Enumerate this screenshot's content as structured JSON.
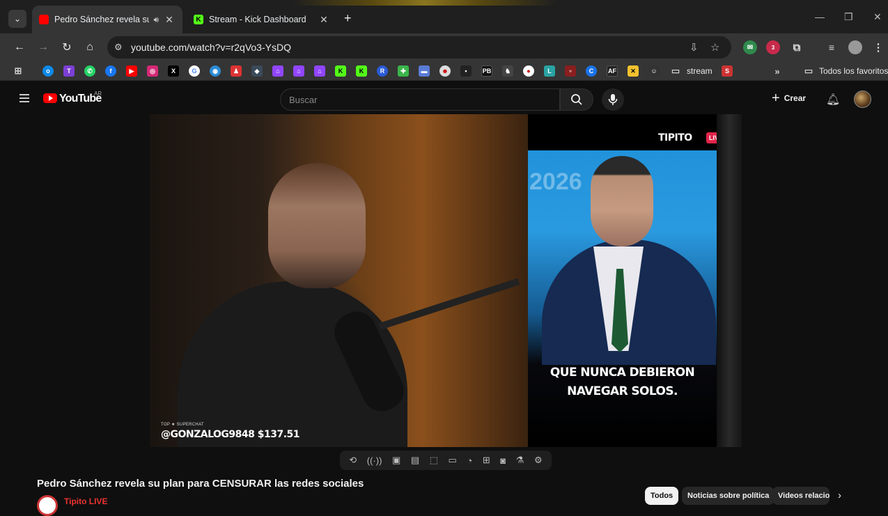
{
  "browser": {
    "tabs": [
      {
        "title": "Pedro Sánchez revela su plan para CENSURAR las redes sociales",
        "favicon": "youtube-icon",
        "active": true,
        "audio": true
      },
      {
        "title": "Stream - Kick Dashboard",
        "favicon": "kick-icon",
        "active": false,
        "audio": false
      }
    ],
    "url": "youtube.com/watch?v=r2qVo3-YsDQ",
    "extension_badge": "3",
    "bookmarks": {
      "folder_label": "stream",
      "all_bookmarks_label": "Todos los favoritos",
      "ext_badge_text": "AF"
    }
  },
  "youtube": {
    "logo_text": "YouTube",
    "country_code": "AR",
    "search_placeholder": "Buscar",
    "create_label": "Crear",
    "video": {
      "title": "Pedro Sánchez revela su plan para CENSURAR las redes sociales",
      "superchat_tag": "TOP ★ SUPERCHAT",
      "superchat_text": "@GONZALOG9848 $137.51",
      "brand_overlay": "TIPITO",
      "live_badge": "LIVE",
      "caption_line1": "QUE NUNCA DEBIERON",
      "caption_line2": "NAVEGAR SOLOS.",
      "background_text": "2026"
    },
    "channel_name": "Tipito LIVE",
    "chips": [
      {
        "label": "Todos",
        "active": true
      },
      {
        "label": "Noticias sobre política",
        "active": false
      },
      {
        "label": "Videos relacionados",
        "active": false
      }
    ]
  },
  "colors": {
    "youtube_red": "#ff0000",
    "live_pink": "#e0244a",
    "kick_green": "#53fc18"
  }
}
